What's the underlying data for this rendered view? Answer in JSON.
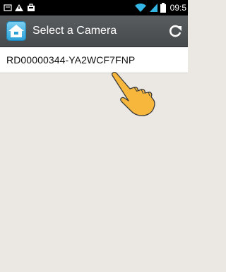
{
  "status_bar": {
    "time": "09:5",
    "icons": [
      "notification-icon",
      "warning-icon",
      "bag-icon",
      "wifi-icon",
      "signal-icon",
      "battery-icon"
    ]
  },
  "action_bar": {
    "title": "Select a Camera",
    "app_icon": "home-camera-icon",
    "refresh_icon": "refresh-icon"
  },
  "cameras": [
    {
      "name": "RD00000344-YA2WCF7FNP"
    }
  ],
  "colors": {
    "background": "#ebe8e4",
    "action_bar": "#4f5255",
    "accent_wifi": "#33b5e5",
    "hand_fill": "#f6b73c"
  }
}
